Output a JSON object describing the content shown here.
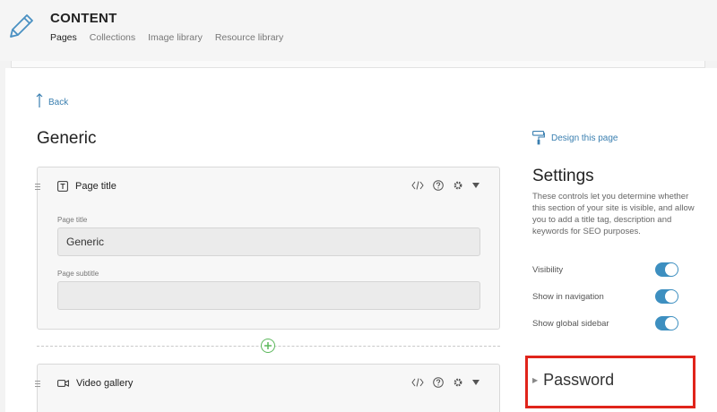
{
  "header": {
    "title": "CONTENT",
    "icon": "pencil-icon",
    "nav": [
      {
        "label": "Pages",
        "active": true
      },
      {
        "label": "Collections",
        "active": false
      },
      {
        "label": "Image library",
        "active": false
      },
      {
        "label": "Resource library",
        "active": false
      }
    ]
  },
  "back_label": "Back",
  "page_heading": "Generic",
  "sections": [
    {
      "title": "Page title",
      "icon": "text-box-icon",
      "fields": [
        {
          "label": "Page title",
          "value": "Generic"
        },
        {
          "label": "Page subtitle",
          "value": ""
        }
      ]
    },
    {
      "title": "Video gallery",
      "icon": "video-camera-icon"
    }
  ],
  "sidebar": {
    "design_link": "Design this page",
    "settings_title": "Settings",
    "settings_desc": "These controls let you determine whether this section of your site is visible, and allow you to add a title tag, description and keywords for SEO purposes.",
    "toggles": [
      {
        "label": "Visibility",
        "on": true
      },
      {
        "label": "Show in navigation",
        "on": true
      },
      {
        "label": "Show global sidebar",
        "on": true
      }
    ],
    "password_label": "Password"
  },
  "colors": {
    "accent": "#3d8fc0",
    "link": "#3a7fb0",
    "add": "#5cb85c",
    "highlight": "#e0241b"
  }
}
